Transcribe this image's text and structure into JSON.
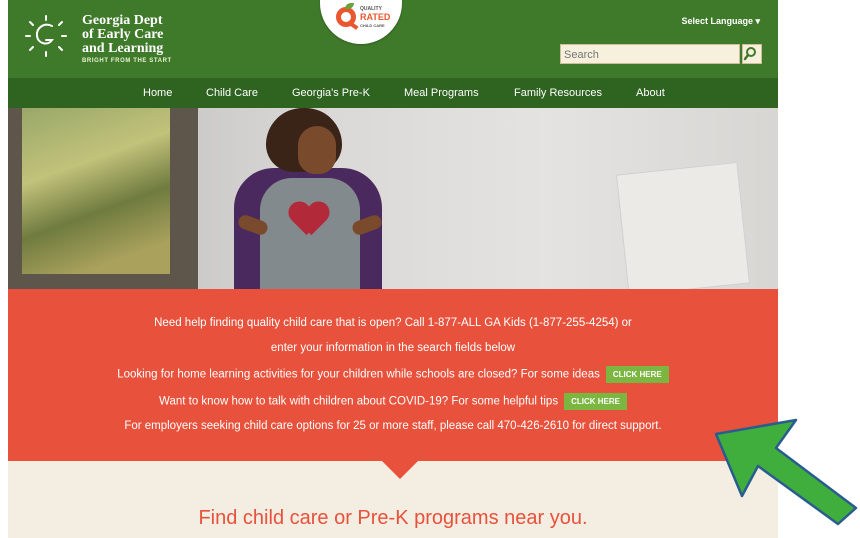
{
  "header": {
    "logo": {
      "line1": "Georgia Dept",
      "line2": "of Early Care",
      "line3": "and Learning",
      "tagline": "BRIGHT FROM THE START"
    },
    "quality_badge": {
      "top": "QUALITY",
      "middle": "RATED",
      "bottom": "CHILD CARE"
    },
    "language_label": "Select Language ▾",
    "search": {
      "placeholder": "Search"
    }
  },
  "nav": {
    "items": [
      {
        "label": "Home"
      },
      {
        "label": "Child Care"
      },
      {
        "label": "Georgia's Pre-K"
      },
      {
        "label": "Meal Programs"
      },
      {
        "label": "Family Resources"
      },
      {
        "label": "About"
      }
    ]
  },
  "panel": {
    "line1": "Need help finding quality child care that is open? Call 1-877-ALL GA Kids (1-877-255-4254) or",
    "line2": "enter your information in the search fields below",
    "line3": "Looking for home learning activities for your children while schools are closed? For some ideas",
    "line4": "Want to know how to talk with children about COVID-19? For some helpful tips",
    "line5": "For employers seeking child care options for 25 or more staff, please call 470-426-2610 for direct support.",
    "cta_label": "CLICK HERE"
  },
  "find": {
    "title": "Find child care or Pre-K programs near you."
  },
  "colors": {
    "header_green": "#3f7a2b",
    "nav_green": "#2f6320",
    "panel_red": "#e8513b",
    "cta_green": "#7bb640",
    "find_bg": "#f3ede2",
    "arrow_green": "#3fae3c"
  }
}
